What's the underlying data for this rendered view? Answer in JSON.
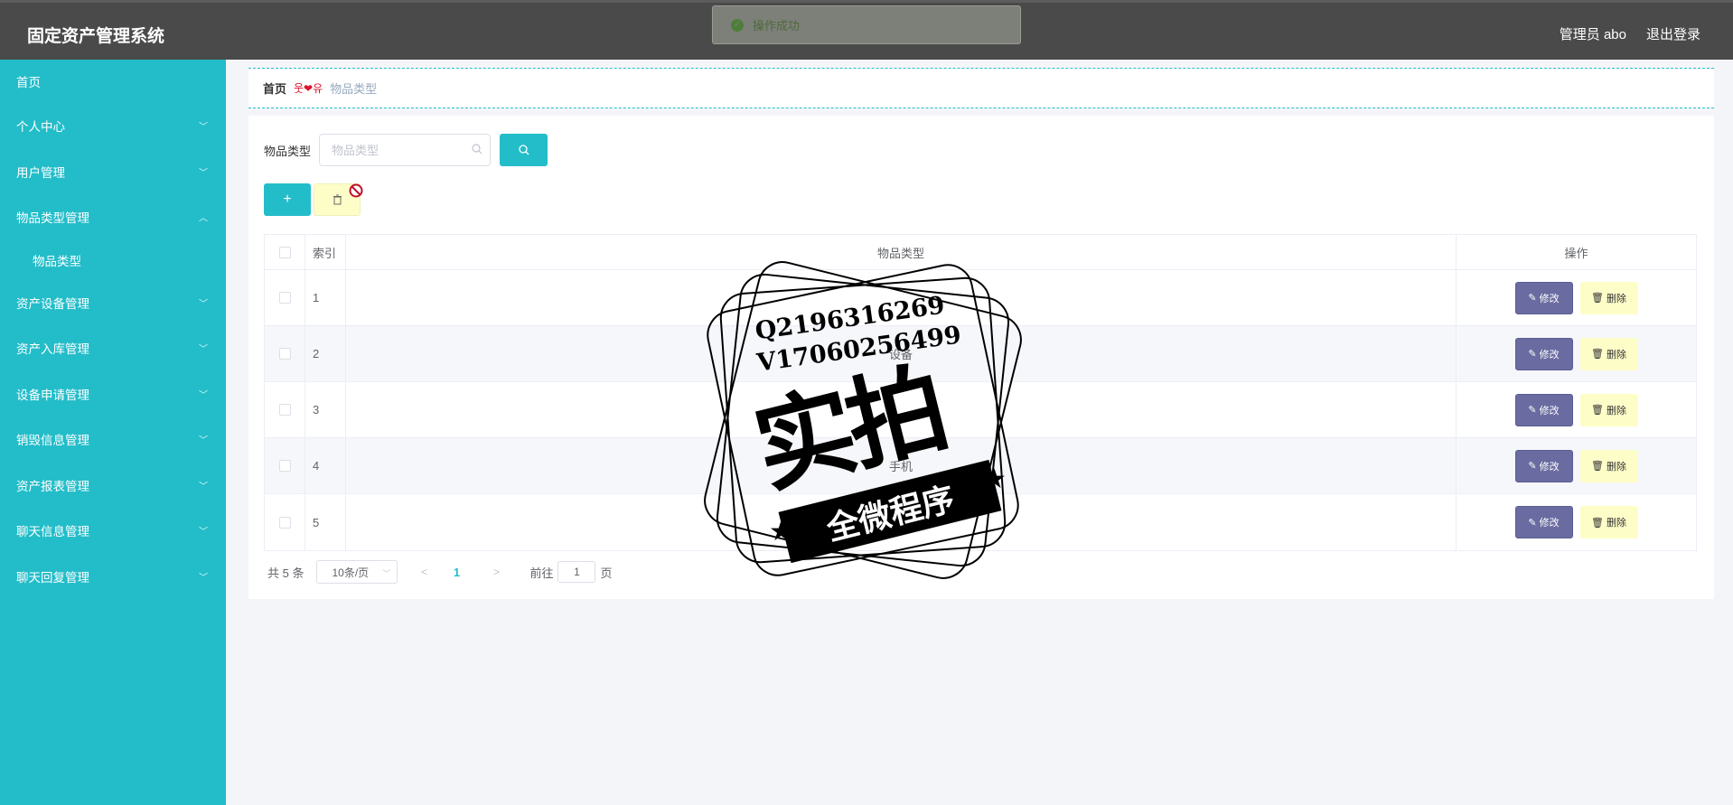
{
  "header": {
    "title": "固定资产管理系统",
    "user_label": "管理员 abo",
    "logout_label": "退出登录"
  },
  "toast": {
    "message": "操作成功"
  },
  "sidebar": {
    "items": [
      {
        "label": "首页",
        "has_chevron": false
      },
      {
        "label": "个人中心",
        "has_chevron": true
      },
      {
        "label": "用户管理",
        "has_chevron": true
      },
      {
        "label": "物品类型管理",
        "has_chevron": true,
        "expanded": true
      },
      {
        "label": "物品类型",
        "sub": true
      },
      {
        "label": "资产设备管理",
        "has_chevron": true
      },
      {
        "label": "资产入库管理",
        "has_chevron": true
      },
      {
        "label": "设备申请管理",
        "has_chevron": true
      },
      {
        "label": "销毁信息管理",
        "has_chevron": true
      },
      {
        "label": "资产报表管理",
        "has_chevron": true
      },
      {
        "label": "聊天信息管理",
        "has_chevron": true
      },
      {
        "label": "聊天回复管理",
        "has_chevron": true
      }
    ]
  },
  "breadcrumb": {
    "home": "首页",
    "separator": "웃❤유",
    "current": "物品类型"
  },
  "search": {
    "label": "物品类型",
    "placeholder": "物品类型",
    "value": ""
  },
  "actions": {
    "add_label": "+"
  },
  "table": {
    "columns": [
      "索引",
      "物品类型",
      "操作"
    ],
    "rows": [
      {
        "index": "1",
        "type": ""
      },
      {
        "index": "2",
        "type": "设备"
      },
      {
        "index": "3",
        "type": ""
      },
      {
        "index": "4",
        "type": "手机"
      },
      {
        "index": "5",
        "type": ""
      }
    ],
    "edit_label": "修改",
    "delete_label": "删除"
  },
  "pagination": {
    "total_text": "共 5 条",
    "page_size": "10条/页",
    "current_page": "1",
    "goto_prefix": "前往",
    "goto_value": "1",
    "goto_suffix": "页"
  },
  "watermark": {
    "line1": "Q2196316269",
    "line2": "V17060256499",
    "big": "实拍",
    "banner": "全微程序"
  },
  "colors": {
    "accent": "#23bdc9",
    "header_bg": "#4a4a4a",
    "edit_button": "#6a6ba0",
    "delete_button": "#fdfdc8"
  }
}
